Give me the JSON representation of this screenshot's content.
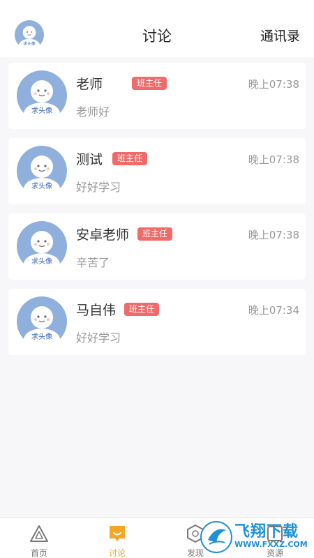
{
  "header": {
    "title": "讨论",
    "contacts_label": "通讯录",
    "avatar_caption": "求头像"
  },
  "chats": [
    {
      "name": "老师",
      "badge": "班主任",
      "time": "晚上07:38",
      "message": "老师好",
      "avatar_caption": "求头像"
    },
    {
      "name": "测试",
      "badge": "班主任",
      "time": "晚上07:38",
      "message": "好好学习",
      "avatar_caption": "求头像"
    },
    {
      "name": "安卓老师",
      "badge": "班主任",
      "time": "晚上07:38",
      "message": "辛苦了",
      "avatar_caption": "求头像"
    },
    {
      "name": "马自伟",
      "badge": "班主任",
      "time": "晚上07:34",
      "message": "好好学习",
      "avatar_caption": "求头像"
    }
  ],
  "tabs": [
    {
      "label": "首页",
      "icon": "triangle-icon",
      "active": false
    },
    {
      "label": "讨论",
      "icon": "chat-bubble-icon",
      "active": true
    },
    {
      "label": "发现",
      "icon": "hexagon-icon",
      "active": false
    },
    {
      "label": "资源",
      "icon": "resource-icon",
      "active": false
    }
  ],
  "watermark": {
    "text": "飞翔下载",
    "url": "WWW.FXXZ.COM"
  },
  "colors": {
    "accent": "#f5a623",
    "badge": "#f06a6a",
    "avatar": "#8fb0dd",
    "background": "#f7f7f9"
  }
}
